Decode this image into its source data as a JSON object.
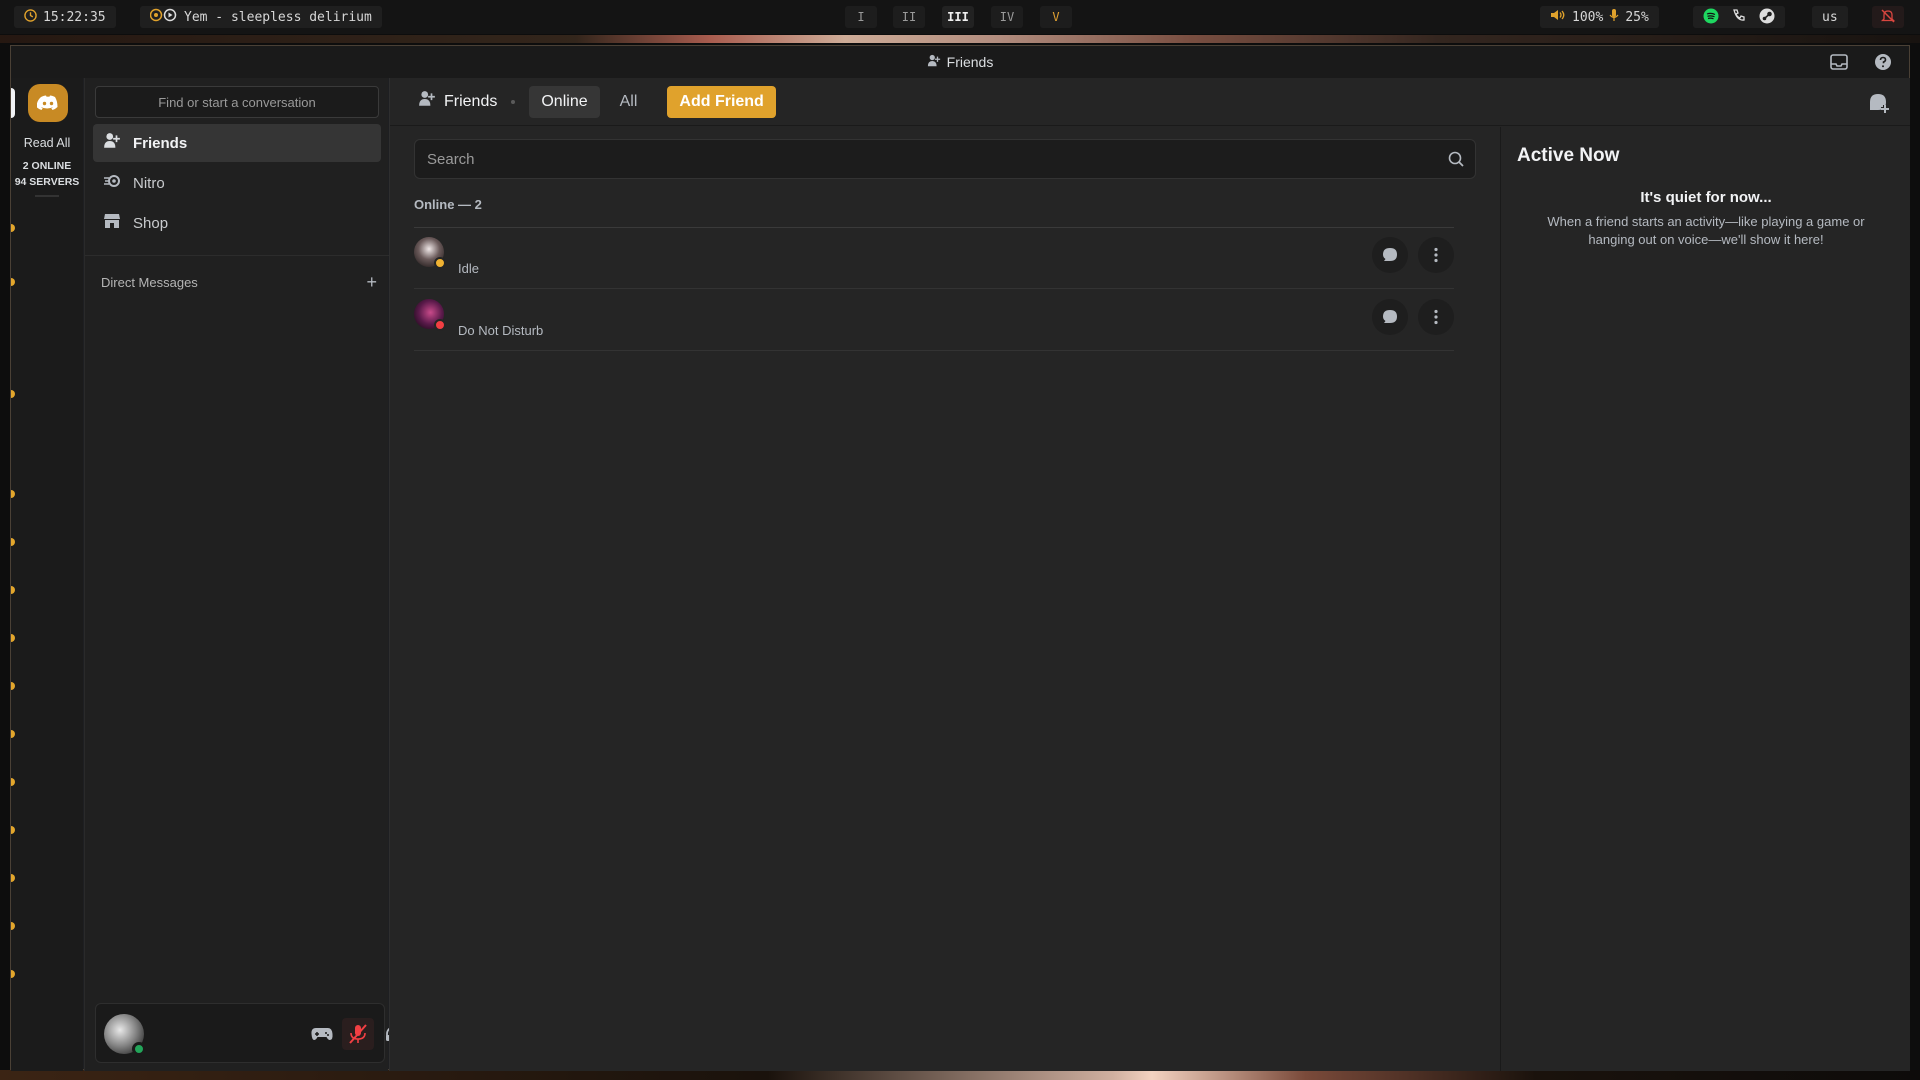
{
  "system_bar": {
    "clock": "15:22:35",
    "now_playing": "Yem - sleepless delirium",
    "workspaces": [
      "I",
      "II",
      "III",
      "IV",
      "V"
    ],
    "active_workspace": "III",
    "volume": "100%",
    "mic": "25%",
    "keyboard_layout": "us",
    "tray_icons": [
      "spotify-icon",
      "phone-icon",
      "steam-icon"
    ]
  },
  "window": {
    "title": "Friends"
  },
  "rail": {
    "read_all": "Read All",
    "online": "2 ONLINE",
    "servers": "94 SERVERS"
  },
  "sidebar": {
    "search_placeholder": "Find or start a conversation",
    "items": [
      {
        "label": "Friends",
        "icon": "friends-icon",
        "active": true
      },
      {
        "label": "Nitro",
        "icon": "nitro-icon",
        "active": false
      },
      {
        "label": "Shop",
        "icon": "shop-icon",
        "active": false
      }
    ],
    "direct_messages_label": "Direct Messages",
    "add_dm": "+"
  },
  "header": {
    "title": "Friends",
    "tabs": [
      {
        "label": "Online",
        "active": true
      },
      {
        "label": "All",
        "active": false
      }
    ],
    "add_friend": "Add Friend"
  },
  "friends": {
    "search_placeholder": "Search",
    "online_count_label": "Online — 2",
    "list": [
      {
        "status_text": "Idle",
        "status": "idle",
        "status_color": "#f0b232"
      },
      {
        "status_text": "Do Not Disturb",
        "status": "dnd",
        "status_color": "#f23f43"
      }
    ]
  },
  "active_now": {
    "title": "Active Now",
    "empty_title": "It's quiet for now...",
    "empty_desc": "When a friend starts an activity—like playing a game or hanging out on voice—we'll show it here!"
  },
  "colors": {
    "accent": "#e0a22c",
    "online": "#23a55a",
    "muted": "#f23f43"
  }
}
